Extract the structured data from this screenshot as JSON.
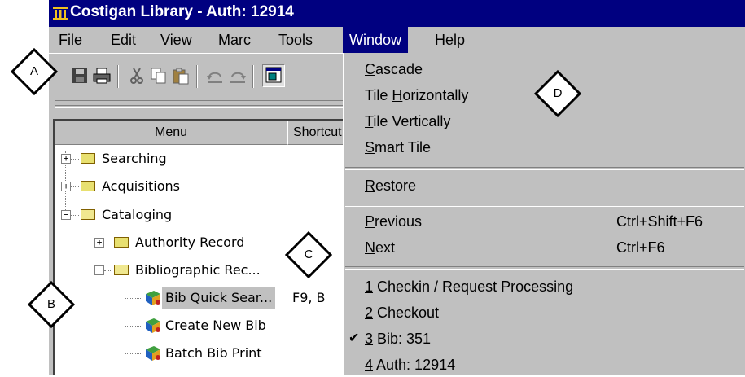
{
  "window": {
    "title": "Costigan Library - Auth: 12914"
  },
  "menubar": {
    "items": [
      {
        "label": "File",
        "mnemonic": "F",
        "rest": "ile"
      },
      {
        "label": "Edit",
        "mnemonic": "E",
        "rest": "dit"
      },
      {
        "label": "View",
        "mnemonic": "V",
        "rest": "iew"
      },
      {
        "label": "Marc",
        "mnemonic": "M",
        "rest": "arc"
      },
      {
        "label": "Tools",
        "mnemonic": "T",
        "rest": "ools"
      },
      {
        "label": "Window",
        "mnemonic": "W",
        "rest": "indow"
      },
      {
        "label": "Help",
        "mnemonic": "H",
        "rest": "elp"
      }
    ]
  },
  "toolbar": {
    "icons": [
      "save-icon",
      "print-icon",
      "cut-icon",
      "copy-icon",
      "paste-icon",
      "undo-icon",
      "redo-icon",
      "window-icon"
    ]
  },
  "menu_panel": {
    "headers": [
      "Menu",
      "Shortcut"
    ],
    "tree": [
      {
        "label": "Searching",
        "expander": "+"
      },
      {
        "label": "Acquisitions",
        "expander": "+"
      },
      {
        "label": "Cataloging",
        "expander": "−"
      },
      {
        "label": "Authority Record",
        "expander": "+"
      },
      {
        "label": "Bibliographic Rec...",
        "expander": "−"
      },
      {
        "label": "Bib Quick Sear...",
        "shortcut": "F9, B"
      },
      {
        "label": "Create New Bib"
      },
      {
        "label": "Batch Bib Print"
      }
    ]
  },
  "window_menu": {
    "items": [
      {
        "pre": "",
        "mn": "C",
        "post": "ascade"
      },
      {
        "pre": "Tile ",
        "mn": "H",
        "post": "orizontally"
      },
      {
        "pre": "",
        "mn": "T",
        "post": "ile Vertically"
      },
      {
        "pre": "",
        "mn": "S",
        "post": "mart Tile"
      },
      {
        "pre": "",
        "mn": "R",
        "post": "estore"
      },
      {
        "pre": "",
        "mn": "P",
        "post": "revious",
        "shortcut": "Ctrl+Shift+F6"
      },
      {
        "pre": "",
        "mn": "N",
        "post": "ext",
        "shortcut": "Ctrl+F6"
      },
      {
        "pre": "",
        "mn": "1",
        "post": " Checkin / Request Processing"
      },
      {
        "pre": "",
        "mn": "2",
        "post": " Checkout"
      },
      {
        "pre": "",
        "mn": "3",
        "post": " Bib: 351",
        "checked": "✔"
      },
      {
        "pre": "",
        "mn": "4",
        "post": " Auth: 12914"
      }
    ]
  },
  "callouts": [
    "A",
    "B",
    "C",
    "D"
  ]
}
